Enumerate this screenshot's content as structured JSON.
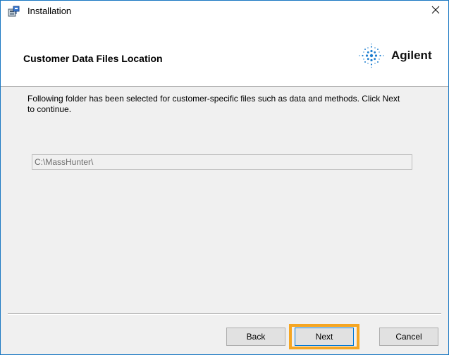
{
  "window": {
    "title": "Installation",
    "icon": "installer-package-icon",
    "close_icon": "close-icon"
  },
  "header": {
    "title": "Customer Data Files Location",
    "logo_text": "Agilent",
    "logo_icon": "agilent-spark-icon"
  },
  "body": {
    "description": "Following folder has been selected for customer-specific files such as data and methods. Click Next to continue.",
    "path_value": "C:\\MassHunter\\"
  },
  "buttons": {
    "back": "Back",
    "next": "Next",
    "cancel": "Cancel"
  },
  "colors": {
    "highlight": "#f5a623",
    "window_border": "#1a78c2",
    "focus_border": "#0078d7"
  }
}
